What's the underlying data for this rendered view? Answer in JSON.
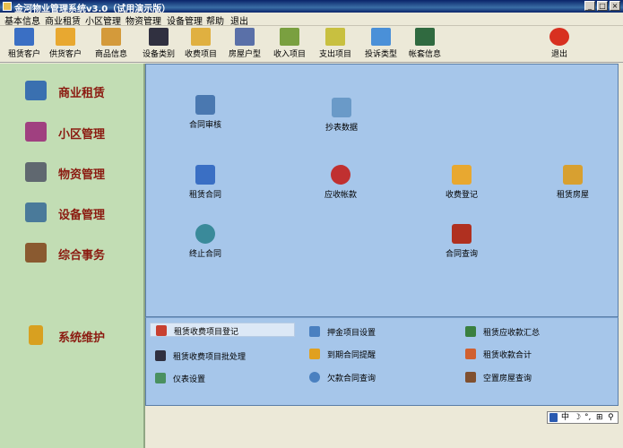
{
  "window": {
    "title": "金河物业管理系统v3.0（试用演示版）",
    "minimize_glyph": "_",
    "maximize_glyph": "□",
    "close_glyph": "×"
  },
  "menu": [
    "基本信息",
    "商业租赁",
    "小区管理",
    "物资管理",
    "设备管理",
    "帮助",
    "退出"
  ],
  "toolbar": {
    "items": [
      {
        "label": "租赁客户",
        "icon": "tenant-client-icon",
        "color": "#3a6fc4"
      },
      {
        "label": "供货客户",
        "icon": "supplier-client-icon",
        "color": "#e8a830"
      },
      {
        "label": "商品信息",
        "icon": "product-info-icon",
        "color": "#d49a3a"
      },
      {
        "label": "设备类别",
        "icon": "equipment-category-icon",
        "color": "#303040"
      },
      {
        "label": "收费项目",
        "icon": "charge-item-icon",
        "color": "#e0b040"
      },
      {
        "label": "房屋户型",
        "icon": "house-type-icon",
        "color": "#5a70a8"
      },
      {
        "label": "收入项目",
        "icon": "income-item-icon",
        "color": "#7aa040"
      },
      {
        "label": "支出项目",
        "icon": "expense-item-icon",
        "color": "#c8c040"
      },
      {
        "label": "投诉类型",
        "icon": "complaint-type-icon",
        "color": "#4a90d8"
      },
      {
        "label": "帐套信息",
        "icon": "account-set-icon",
        "color": "#306a40"
      },
      {
        "label": "退出",
        "icon": "exit-icon",
        "color": "#d83020"
      }
    ]
  },
  "sidebar": {
    "items": [
      {
        "label": "商业租赁",
        "icon": "commercial-lease-icon",
        "color": "#3a70b0"
      },
      {
        "label": "小区管理",
        "icon": "community-icon",
        "color": "#a04080"
      },
      {
        "label": "物资管理",
        "icon": "materials-icon",
        "color": "#606870"
      },
      {
        "label": "设备管理",
        "icon": "equipment-icon",
        "color": "#4a7a9a"
      },
      {
        "label": "综合事务",
        "icon": "general-affairs-icon",
        "color": "#8a5a30"
      },
      {
        "label": "系统维护",
        "icon": "key-icon",
        "color": "#d8a020"
      }
    ]
  },
  "main": {
    "items": [
      {
        "label": "合同审核",
        "icon": "contract-review-icon",
        "color": "#4a78b0"
      },
      {
        "label": "抄表数据",
        "icon": "meter-data-icon",
        "color": "#6a9ac8"
      },
      {
        "label": "租赁合同",
        "icon": "lease-contract-icon",
        "color": "#3a6fc4"
      },
      {
        "label": "应收帐款",
        "icon": "receivables-icon",
        "color": "#c03030"
      },
      {
        "label": "收费登记",
        "icon": "charge-register-icon",
        "color": "#e8a830"
      },
      {
        "label": "租赁房屋",
        "icon": "lease-house-icon",
        "color": "#d8a030"
      },
      {
        "label": "终止合同",
        "icon": "terminate-contract-icon",
        "color": "#3a8a9a"
      },
      {
        "label": "合同查询",
        "icon": "contract-query-icon",
        "color": "#b03020"
      }
    ]
  },
  "bottom": {
    "items": [
      {
        "label": "租赁收费项目登记",
        "icon": "fee-register-icon",
        "color": "#c84030"
      },
      {
        "label": "押金项目设置",
        "icon": "deposit-setting-icon",
        "color": "#4a80c0"
      },
      {
        "label": "租赁应收款汇总",
        "icon": "receivable-summary-icon",
        "color": "#3a8040"
      },
      {
        "label": "租赁收费项目批处理",
        "icon": "fee-batch-icon",
        "color": "#303040"
      },
      {
        "label": "到期合同提醒",
        "icon": "expiry-reminder-icon",
        "color": "#e0a020"
      },
      {
        "label": "租赁收款合计",
        "icon": "collection-total-icon",
        "color": "#d06030"
      },
      {
        "label": "仪表设置",
        "icon": "meter-setting-icon",
        "color": "#4a9060"
      },
      {
        "label": "欠款合同查询",
        "icon": "arrears-query-icon",
        "color": "#4a80c0"
      },
      {
        "label": "空置房屋查询",
        "icon": "vacant-house-icon",
        "color": "#805030"
      }
    ]
  },
  "ime": {
    "glyphs": [
      "中",
      "☽",
      "°,",
      "⊞",
      "⚲"
    ]
  }
}
